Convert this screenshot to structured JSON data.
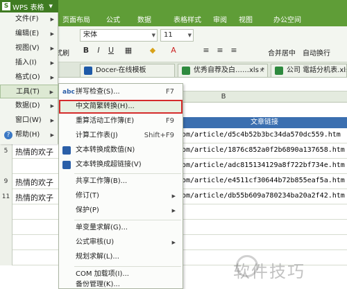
{
  "app": {
    "title": "WPS 表格",
    "logo": "S",
    "menubar": [
      "页面布局",
      "公式",
      "数据",
      "表格样式",
      "审阅",
      "视图",
      "办公空间"
    ]
  },
  "ribbon": {
    "font": "宋体",
    "font_size": "11",
    "paste_label": "式刷",
    "bold": "B",
    "italic": "I",
    "merge_label": "合并居中",
    "wrap_label": "自动换行"
  },
  "doc_tabs": [
    {
      "label": "Docer-在线模板",
      "icon": "docer-icon"
    },
    {
      "label": "优秀自荐及白……xls *",
      "icon": "excel-icon"
    },
    {
      "label": "公司 電話分机表.xls",
      "icon": "excel-icon"
    }
  ],
  "sheet": {
    "column_b": "B",
    "header_cell": "文章链接",
    "rows": [
      {
        "num": "",
        "a": "",
        "b": "om/article/d5c4b52b3bc34da570dc559.htm"
      },
      {
        "num": "5",
        "a": "热情的欢子",
        "b": "om/article/1876c852a0f2b6890a137658.htm"
      },
      {
        "num": "",
        "a": "",
        "b": "om/article/adc815134129a8f722bf734e.htm"
      },
      {
        "num": "9",
        "a": "热情的欢子",
        "b": "om/article/e4511cf30644b72b855eaf5a.htm"
      },
      {
        "num": "11",
        "a": "热情的欢子",
        "b": "om/article/db55b609a780234ba20a2f42.htm"
      }
    ]
  },
  "wps_menu": [
    {
      "label": "文件(F)",
      "arrow": true
    },
    {
      "label": "编辑(E)",
      "arrow": true
    },
    {
      "label": "视图(V)",
      "arrow": true
    },
    {
      "label": "插入(I)",
      "arrow": true
    },
    {
      "label": "格式(O)",
      "arrow": true
    },
    {
      "label": "工具(T)",
      "arrow": true,
      "active": true
    },
    {
      "label": "数据(D)",
      "arrow": true
    },
    {
      "label": "窗口(W)",
      "arrow": true
    },
    {
      "label": "帮助(H)",
      "arrow": true,
      "icon": "help-icon"
    }
  ],
  "tools_submenu": [
    {
      "label": "拼写检查(S)...",
      "shortcut": "F7",
      "icon": "spellcheck-icon"
    },
    {
      "label": "中文简繁转换(H)...",
      "highlight": true
    },
    {
      "label": "重算活动工作簿(E)",
      "shortcut": "F9"
    },
    {
      "label": "计算工作表(J)",
      "shortcut": "Shift+F9"
    },
    {
      "label": "文本转换成数值(N)",
      "icon": "text-to-number-icon"
    },
    {
      "label": "文本转换成超链接(V)",
      "icon": "text-to-link-icon"
    },
    {
      "label": "共享工作簿(B)...",
      "sep_before": true
    },
    {
      "label": "修订(T)",
      "arrow": true
    },
    {
      "label": "保护(P)",
      "arrow": true
    },
    {
      "label": "单变量求解(G)...",
      "sep_before": true
    },
    {
      "label": "公式审核(U)",
      "arrow": true
    },
    {
      "label": "规划求解(L)..."
    },
    {
      "label": "COM 加载项(I)...",
      "sep_before": true
    },
    {
      "label": "备份管理(K)..."
    }
  ],
  "watermark": "软件技巧",
  "colors": {
    "title_green": "#5f9d37",
    "header_blue": "#3b6fb0",
    "highlight_red": "#d52b2b"
  }
}
